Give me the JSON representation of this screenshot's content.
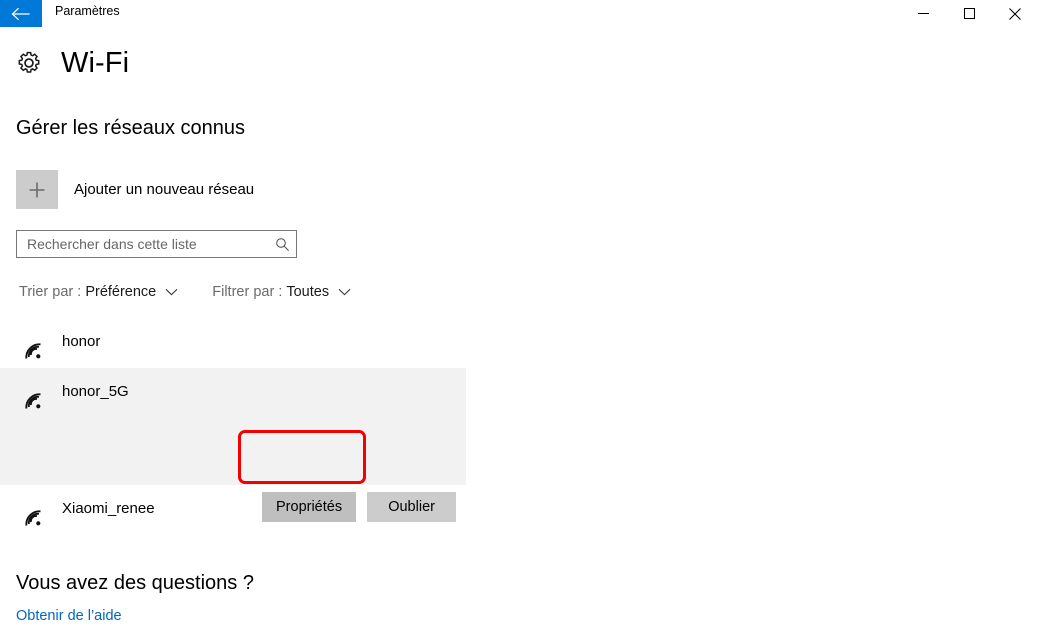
{
  "window": {
    "title": "Paramètres",
    "back_icon": "back-arrow-icon",
    "controls": {
      "minimize": "minimize-icon",
      "maximize": "maximize-icon",
      "close": "close-icon"
    }
  },
  "page": {
    "icon": "gear-icon",
    "title": "Wi-Fi",
    "section_heading": "Gérer les réseaux connus"
  },
  "add_network": {
    "icon": "plus-icon",
    "label": "Ajouter un nouveau réseau"
  },
  "search": {
    "placeholder": "Rechercher dans cette liste",
    "value": "",
    "icon": "search-icon"
  },
  "filters": {
    "sort": {
      "label": "Trier par :",
      "value": "Préférence",
      "icon": "chevron-down-icon"
    },
    "filter": {
      "label": "Filtrer par :",
      "value": "Toutes",
      "icon": "chevron-down-icon"
    }
  },
  "networks": [
    {
      "name": "honor",
      "icon": "wifi-icon",
      "selected": false
    },
    {
      "name": "honor_5G",
      "icon": "wifi-icon",
      "selected": true,
      "actions": [
        {
          "label": "Propriétés",
          "state": "hovered",
          "highlighted": true
        },
        {
          "label": "Oublier",
          "state": "normal",
          "highlighted": false
        }
      ]
    },
    {
      "name": "Xiaomi_renee",
      "icon": "wifi-icon",
      "selected": false
    }
  ],
  "footer": {
    "heading": "Vous avez des questions ?",
    "link": "Obtenir de l’aide"
  },
  "colors": {
    "accent": "#0078D7",
    "link": "#0067C0",
    "annotation": "#f40000",
    "row_selected_bg": "#f2f2f2",
    "button_bg": "#cccccc",
    "button_hover_bg": "#bfbfbf"
  }
}
